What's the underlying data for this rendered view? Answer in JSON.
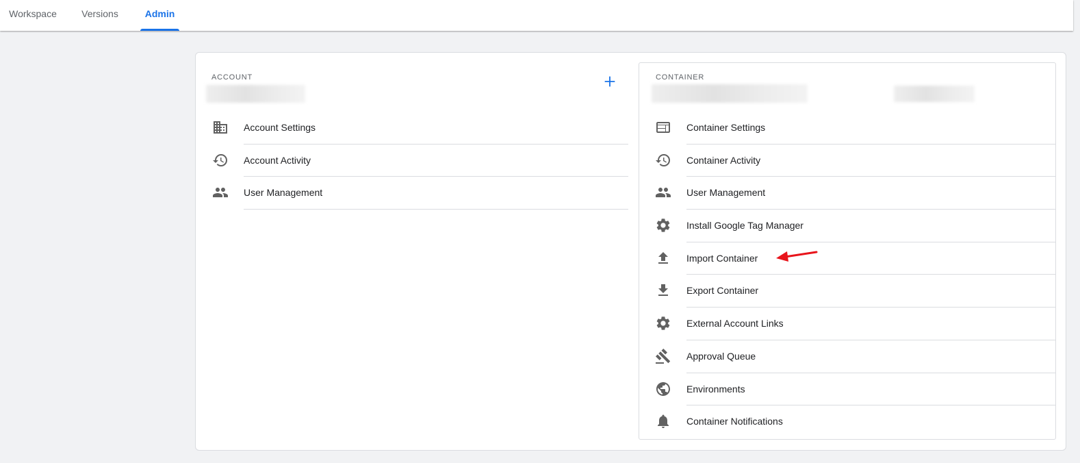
{
  "tabs": [
    {
      "label": "Workspace",
      "active": false
    },
    {
      "label": "Versions",
      "active": false
    },
    {
      "label": "Admin",
      "active": true
    }
  ],
  "colors": {
    "accent": "#1a73e8",
    "annotation_arrow": "#e8141b"
  },
  "account": {
    "section_label": "ACCOUNT",
    "add_icon": "plus-icon",
    "items": [
      {
        "label": "Account Settings",
        "icon": "building-icon"
      },
      {
        "label": "Account Activity",
        "icon": "history-icon"
      },
      {
        "label": "User Management",
        "icon": "people-icon"
      }
    ]
  },
  "container": {
    "section_label": "CONTAINER",
    "items": [
      {
        "label": "Container Settings",
        "icon": "window-icon"
      },
      {
        "label": "Container Activity",
        "icon": "history-icon"
      },
      {
        "label": "User Management",
        "icon": "people-icon"
      },
      {
        "label": "Install Google Tag Manager",
        "icon": "gear-icon"
      },
      {
        "label": "Import Container",
        "icon": "upload-icon"
      },
      {
        "label": "Export Container",
        "icon": "download-icon"
      },
      {
        "label": "External Account Links",
        "icon": "gear-icon"
      },
      {
        "label": "Approval Queue",
        "icon": "gavel-icon"
      },
      {
        "label": "Environments",
        "icon": "globe-icon"
      },
      {
        "label": "Container Notifications",
        "icon": "bell-icon"
      }
    ]
  }
}
